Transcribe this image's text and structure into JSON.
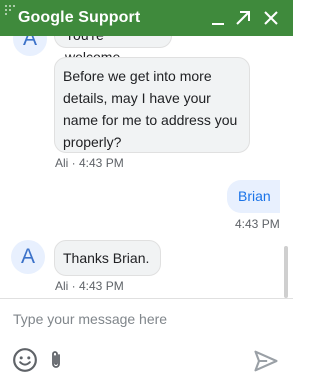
{
  "window": {
    "title": "Google Support",
    "icons": [
      "grip-icon",
      "minimize-icon",
      "popout-icon",
      "close-icon"
    ],
    "header_color": "#3f8a3c"
  },
  "messages": [
    {
      "sender": "agent",
      "avatar": "A",
      "text": "You're welcome",
      "partial": true
    },
    {
      "sender": "agent",
      "lines": [
        "Before we get into more",
        "details, may I have your",
        "name for me to address you",
        "properly?"
      ],
      "meta": "Ali · 4:43 PM"
    },
    {
      "sender": "user",
      "text": "Brian",
      "meta": "4:43 PM"
    },
    {
      "sender": "agent",
      "avatar": "A",
      "text": "Thanks Brian.",
      "meta": "Ali · 4:43 PM"
    }
  ],
  "composer": {
    "placeholder": "Type your message here",
    "icons": [
      "emoji-icon",
      "attachment-icon",
      "send-icon"
    ]
  }
}
